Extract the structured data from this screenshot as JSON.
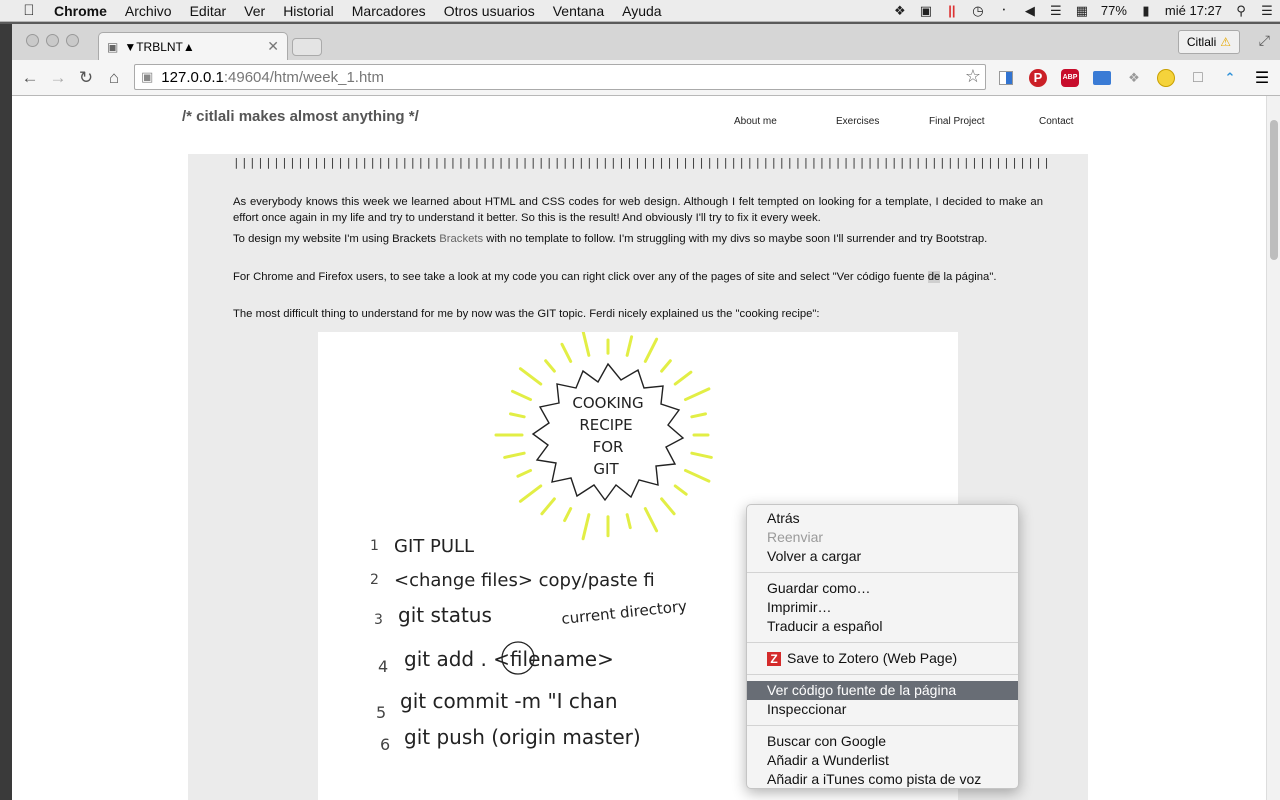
{
  "menubar": {
    "app": "Chrome",
    "items": [
      "Archivo",
      "Editar",
      "Ver",
      "Historial",
      "Marcadores",
      "Otros usuarios",
      "Ventana",
      "Ayuda"
    ],
    "battery": "77%",
    "clock": "mié 17:27"
  },
  "tab": {
    "title": "▼TRBLNT▲"
  },
  "profile": {
    "name": "Citlali"
  },
  "address": {
    "host": "127.0.0.1",
    "path": ":49604/htm/week_1.htm"
  },
  "site": {
    "title": "/* citlali makes almost anything */",
    "nav": [
      "About me",
      "Exercises",
      "Final Project",
      "Contact"
    ]
  },
  "content": {
    "bars": "||||||||||||||||||||||||||||||||||||||||||||||||||||||||||||||||||||||||||||||||||||||||||||||||||||||",
    "p1": "As everybody knows this week we learned about HTML and CSS codes for web design. Although I felt tempted on looking for a template, I decided to make an effort once again in my life and try to understand it better. So this is the result! And obviously I'll try to fix it every week.",
    "p2_before": "To design my website I'm using Brackets ",
    "p2_link": "Brackets",
    "p2_after": " with no template to follow. I'm struggling with my divs so maybe soon I'll surrender and try Bootstrap.",
    "p3_before": "For Chrome and Firefox users, to see take a look at my code you can right click over any of the pages of site and select \"Ver código fuente ",
    "p3_hl": "de",
    "p3_after": " la página\".",
    "p4": "The most difficult thing to understand for me by now was the GIT topic. Ferdi nicely explained us the \"cooking recipe\":"
  },
  "recipe": {
    "burst": [
      "COOKING",
      "RECIPE",
      "FOR",
      "GIT"
    ],
    "steps": [
      {
        "n": "1",
        "text": "GIT PULL"
      },
      {
        "n": "2",
        "text": "<change files> copy/paste fi"
      },
      {
        "n": "3",
        "text": "git status"
      },
      {
        "n": "4",
        "text": "git add . <filename>"
      },
      {
        "n": "5",
        "text": "git commit -m \"I chan"
      },
      {
        "n": "6",
        "text": "git push (origin master)"
      }
    ],
    "annotation": "current directory"
  },
  "context_menu": {
    "back": "Atrás",
    "forward": "Reenviar",
    "reload": "Volver a cargar",
    "save_as": "Guardar como…",
    "print": "Imprimir…",
    "translate": "Traducir a español",
    "zotero": "Save to Zotero (Web Page)",
    "view_source": "Ver código fuente de la página",
    "inspect": "Inspeccionar",
    "search_google": "Buscar con Google",
    "wunderlist": "Añadir a Wunderlist",
    "itunes": "Añadir a iTunes como pista de voz"
  },
  "colors": {
    "menu_highlight": "#686d75",
    "burst_rays": "#e2ee45",
    "content_bg": "#ebebeb"
  }
}
